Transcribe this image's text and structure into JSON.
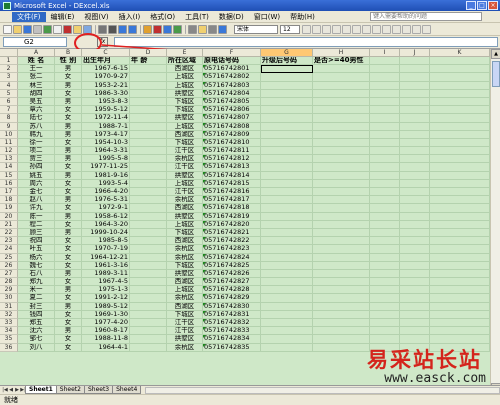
{
  "window": {
    "title": "Microsoft Excel - DExcel.xls"
  },
  "menu": {
    "items": [
      "文件(F)",
      "编辑(E)",
      "视图(V)",
      "插入(I)",
      "格式(O)",
      "工具(T)",
      "数据(D)",
      "窗口(W)",
      "帮助(H)"
    ],
    "help_placeholder": "键入需要帮助的问题"
  },
  "toolbar": {
    "font_name": "宋体",
    "font_size": "12"
  },
  "formula_bar": {
    "name_box": "G2",
    "fx": "fx",
    "formula": ""
  },
  "columns": [
    "A",
    "B",
    "C",
    "D",
    "E",
    "F",
    "G",
    "H",
    "I",
    "J",
    "K"
  ],
  "selected_column": "G",
  "headers": [
    "姓 名",
    "性 别",
    "出生年月",
    "年 龄",
    "所在区域",
    "原电话号码",
    "升级后号码",
    "是否>=40男性"
  ],
  "rows": [
    [
      "王一",
      "男",
      "1967-6-15",
      "",
      "西湖区",
      "05716742801"
    ],
    [
      "张二",
      "女",
      "1970-9-27",
      "",
      "上城区",
      "05716742802"
    ],
    [
      "林三",
      "男",
      "1953-2-21",
      "",
      "上城区",
      "05716742803"
    ],
    [
      "胡四",
      "女",
      "1986-3-30",
      "",
      "拱墅区",
      "05716742804"
    ],
    [
      "吴五",
      "男",
      "1953-8-3",
      "",
      "下城区",
      "05716742805"
    ],
    [
      "章六",
      "女",
      "1959-5-12",
      "",
      "下城区",
      "05716742806"
    ],
    [
      "陆七",
      "女",
      "1972-11-4",
      "",
      "拱墅区",
      "05716742807"
    ],
    [
      "苏八",
      "男",
      "1988-7-1",
      "",
      "上城区",
      "05716742808"
    ],
    [
      "韩九",
      "男",
      "1973-4-17",
      "",
      "西湖区",
      "05716742809"
    ],
    [
      "徐一",
      "女",
      "1954-10-3",
      "",
      "下城区",
      "05716742810"
    ],
    [
      "项二",
      "男",
      "1964-3-31",
      "",
      "江干区",
      "05716742811"
    ],
    [
      "贾三",
      "男",
      "1995-5-8",
      "",
      "余杭区",
      "05716742812"
    ],
    [
      "孙四",
      "女",
      "1977-11-25",
      "",
      "江干区",
      "05716742813"
    ],
    [
      "姚五",
      "男",
      "1981-9-16",
      "",
      "拱墅区",
      "05716742814"
    ],
    [
      "周六",
      "女",
      "1993-5-4",
      "",
      "上城区",
      "05716742815"
    ],
    [
      "金七",
      "女",
      "1966-4-20",
      "",
      "江干区",
      "05716742816"
    ],
    [
      "赵八",
      "男",
      "1976-5-31",
      "",
      "余杭区",
      "05716742817"
    ],
    [
      "许九",
      "女",
      "1972-9-1",
      "",
      "西湖区",
      "05716742818"
    ],
    [
      "陈一",
      "男",
      "1958-6-12",
      "",
      "拱墅区",
      "05716742819"
    ],
    [
      "程二",
      "女",
      "1964-3-20",
      "",
      "上城区",
      "05716742820"
    ],
    [
      "顾三",
      "男",
      "1999-10-24",
      "",
      "下城区",
      "05716742821"
    ],
    [
      "祝四",
      "女",
      "1985-8-5",
      "",
      "西湖区",
      "05716742822"
    ],
    [
      "叶五",
      "女",
      "1970-7-19",
      "",
      "余杭区",
      "05716742823"
    ],
    [
      "杨六",
      "女",
      "1964-12-21",
      "",
      "余杭区",
      "05716742824"
    ],
    [
      "魏七",
      "女",
      "1961-3-16",
      "",
      "下城区",
      "05716742825"
    ],
    [
      "石八",
      "男",
      "1989-3-11",
      "",
      "拱墅区",
      "05716742826"
    ],
    [
      "郑九",
      "女",
      "1967-4-5",
      "",
      "西湖区",
      "05716742827"
    ],
    [
      "米一",
      "男",
      "1975-1-3",
      "",
      "上城区",
      "05716742828"
    ],
    [
      "夏二",
      "女",
      "1991-2-12",
      "",
      "余杭区",
      "05716742829"
    ],
    [
      "封三",
      "男",
      "1989-5-12",
      "",
      "西湖区",
      "05716742830"
    ],
    [
      "钱四",
      "女",
      "1969-1-30",
      "",
      "下城区",
      "05716742831"
    ],
    [
      "郑五",
      "女",
      "1977-4-20",
      "",
      "江干区",
      "05716742832"
    ],
    [
      "沈六",
      "男",
      "1960-8-17",
      "",
      "江干区",
      "05716742833"
    ],
    [
      "邹七",
      "女",
      "1988-11-8",
      "",
      "拱墅区",
      "05716742834"
    ],
    [
      "刘八",
      "女",
      "1964-4-1",
      "",
      "余杭区",
      "05716742835"
    ]
  ],
  "sheets": [
    "Sheet1",
    "Sheet2",
    "Sheet3",
    "Sheet4"
  ],
  "active_sheet": "Sheet1",
  "status": "就绪",
  "watermark": {
    "line1": "易采站长站",
    "line2": "www.easck.com"
  },
  "colors": {
    "grid_bg": "#cfe8c8",
    "annotation": "#e02020",
    "watermark_red": "#d4241c"
  }
}
